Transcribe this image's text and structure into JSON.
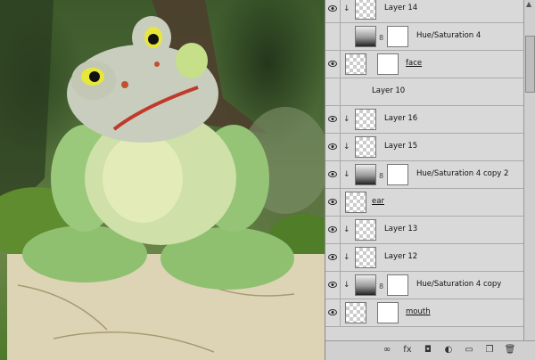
{
  "canvas": {
    "description_icon": "frog-figurine-photo"
  },
  "layers": [
    {
      "name": "Layer 14",
      "visible": true,
      "clipped": true,
      "kind": "pixel",
      "underline": false
    },
    {
      "name": "Hue/Saturation 4",
      "visible": false,
      "clipped": false,
      "kind": "adjustment",
      "underline": false
    },
    {
      "name": "face",
      "visible": true,
      "clipped": false,
      "kind": "pixel-mask",
      "underline": true
    },
    {
      "name": "Layer 10",
      "visible": false,
      "clipped": false,
      "kind": "text-only",
      "underline": false
    },
    {
      "name": "Layer 16",
      "visible": true,
      "clipped": true,
      "kind": "pixel",
      "underline": false
    },
    {
      "name": "Layer 15",
      "visible": true,
      "clipped": true,
      "kind": "pixel",
      "underline": false
    },
    {
      "name": "Hue/Saturation 4 copy 2",
      "visible": true,
      "clipped": true,
      "kind": "adjustment",
      "underline": false
    },
    {
      "name": "ear",
      "visible": true,
      "clipped": false,
      "kind": "pixel",
      "underline": true
    },
    {
      "name": "Layer 13",
      "visible": true,
      "clipped": true,
      "kind": "pixel",
      "underline": false
    },
    {
      "name": "Layer 12",
      "visible": true,
      "clipped": true,
      "kind": "pixel",
      "underline": false
    },
    {
      "name": "Hue/Saturation 4 copy",
      "visible": true,
      "clipped": true,
      "kind": "adjustment",
      "underline": false
    },
    {
      "name": "mouth",
      "visible": true,
      "clipped": false,
      "kind": "pixel-mask",
      "underline": true
    }
  ],
  "toolbar": [
    "link-icon",
    "fx-icon",
    "mask-icon",
    "adjustment-icon",
    "group-folder-icon",
    "new-layer-icon",
    "trash-icon"
  ],
  "toolbar_labels": [
    "∞",
    "fx",
    "◘",
    "◐",
    "▭",
    "❐",
    "🗑"
  ]
}
